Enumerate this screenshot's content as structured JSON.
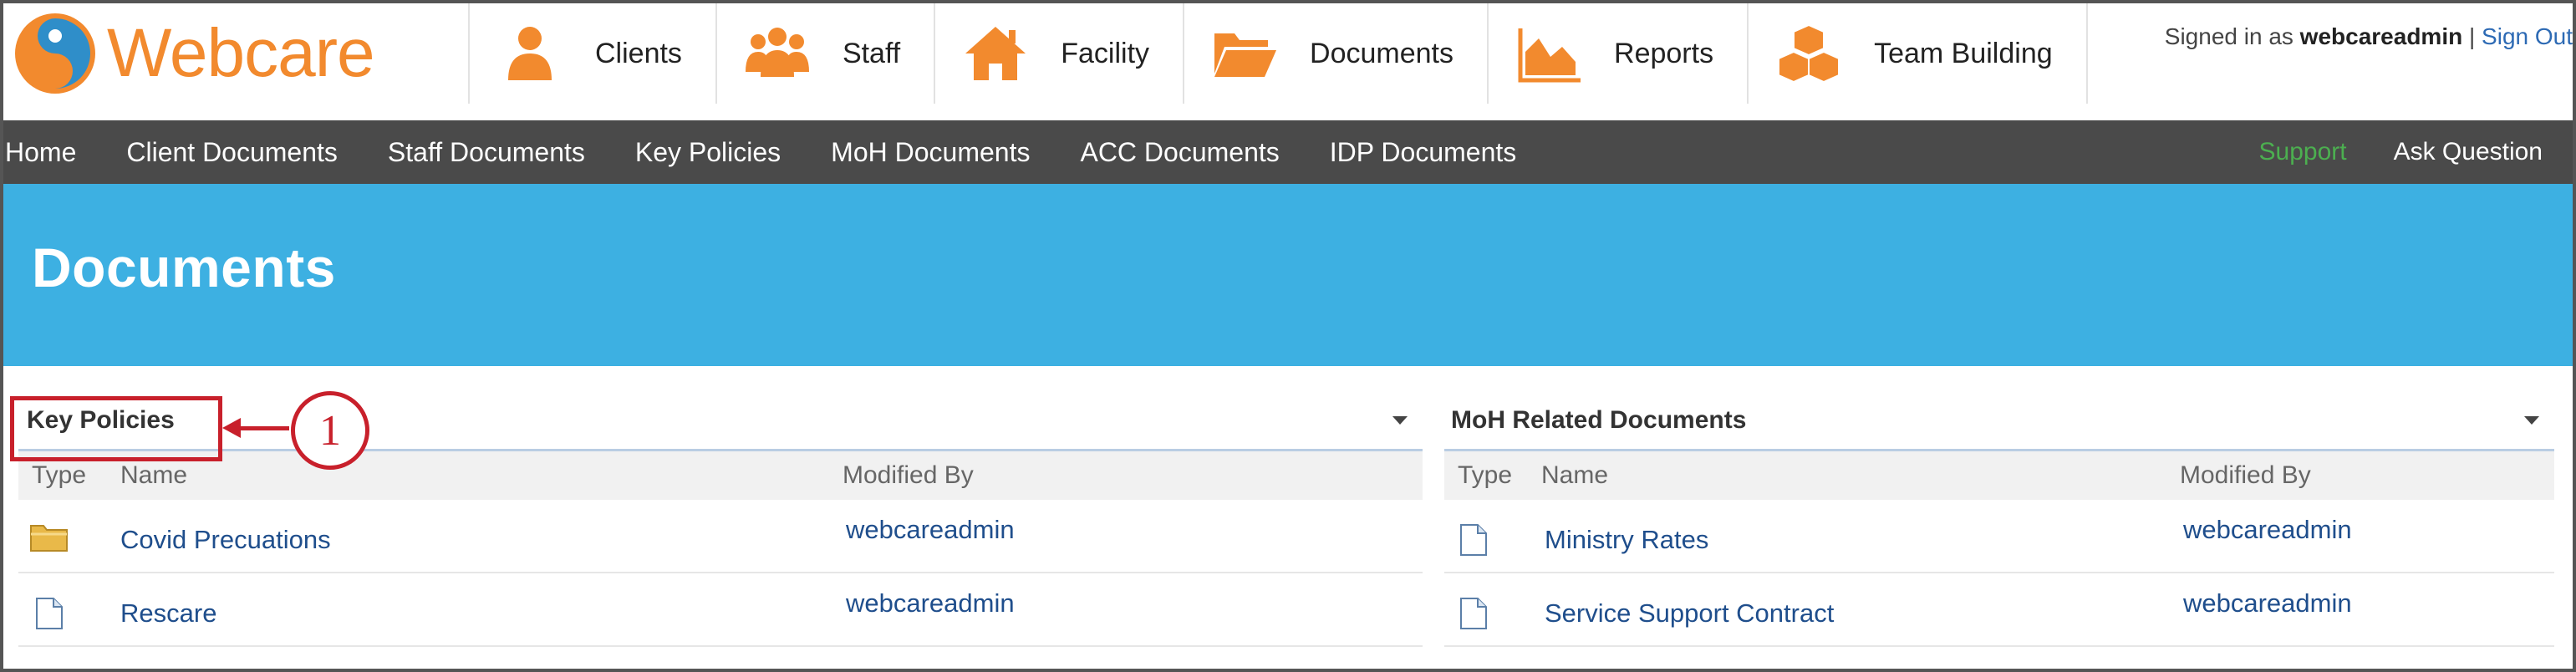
{
  "app": {
    "logo_text": "Webcare",
    "brand_color": "#f28a2e"
  },
  "main_nav": {
    "items": [
      {
        "label": "Clients",
        "icon": "person-icon"
      },
      {
        "label": "Staff",
        "icon": "group-icon"
      },
      {
        "label": "Facility",
        "icon": "house-icon"
      },
      {
        "label": "Documents",
        "icon": "folder-icon"
      },
      {
        "label": "Reports",
        "icon": "area-chart-icon"
      },
      {
        "label": "Team Building",
        "icon": "cubes-icon"
      }
    ],
    "icon_color": "#f28a2e"
  },
  "account": {
    "signed_in_prefix": "Signed in as ",
    "username": "webcareadmin",
    "separator": " | ",
    "sign_out": "Sign Out"
  },
  "sub_nav": {
    "items": [
      "Home",
      "Client Documents",
      "Staff Documents",
      "Key Policies",
      "MoH Documents",
      "ACC Documents",
      "IDP Documents"
    ],
    "support": "Support",
    "ask_question": "Ask Question"
  },
  "page": {
    "title": "Documents",
    "banner_color": "#3db0e2"
  },
  "panels": {
    "left": {
      "title": "Key Policies",
      "columns": {
        "type": "Type",
        "name": "Name",
        "modified_by": "Modified By"
      },
      "rows": [
        {
          "type": "folder",
          "name": "Covid Precuations",
          "modified_by": "webcareadmin"
        },
        {
          "type": "document",
          "name": "Rescare",
          "modified_by": "webcareadmin"
        }
      ]
    },
    "right": {
      "title": "MoH Related Documents",
      "columns": {
        "type": "Type",
        "name": "Name",
        "modified_by": "Modified By"
      },
      "rows": [
        {
          "type": "document",
          "name": "Ministry Rates",
          "modified_by": "webcareadmin"
        },
        {
          "type": "document",
          "name": "Service Support Contract",
          "modified_by": "webcareadmin"
        }
      ]
    }
  },
  "annotation": {
    "number": "1",
    "color": "#c8202b"
  }
}
